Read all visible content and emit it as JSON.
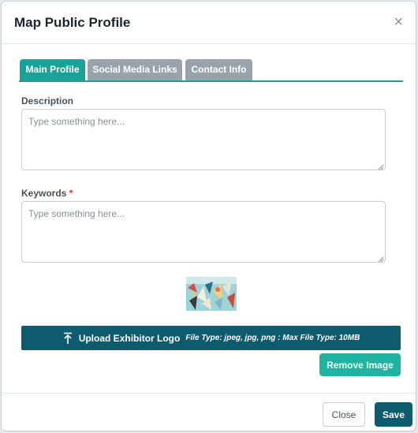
{
  "modal": {
    "title": "Map Public Profile",
    "close_glyph": "×"
  },
  "tabs": [
    {
      "label": "Main Profile",
      "active": true
    },
    {
      "label": "Social Media Links",
      "active": false
    },
    {
      "label": "Contact Info",
      "active": false
    }
  ],
  "form": {
    "description": {
      "label": "Description",
      "placeholder": "Type something here...",
      "value": ""
    },
    "keywords": {
      "label": "Keywords",
      "required_mark": "*",
      "placeholder": "Type something here...",
      "value": ""
    }
  },
  "upload": {
    "icon": "upload-icon",
    "label": "Upload Exhibitor Logo",
    "hint": "File Type: jpeg, jpg, png : Max File Type: 10MB",
    "remove_label": "Remove Image"
  },
  "footer": {
    "close_label": "Close",
    "save_label": "Save"
  },
  "colors": {
    "accent": "#17a398",
    "primary": "#0e5b6e",
    "inactive_tab": "#9aa3ab",
    "required": "#e03131"
  }
}
